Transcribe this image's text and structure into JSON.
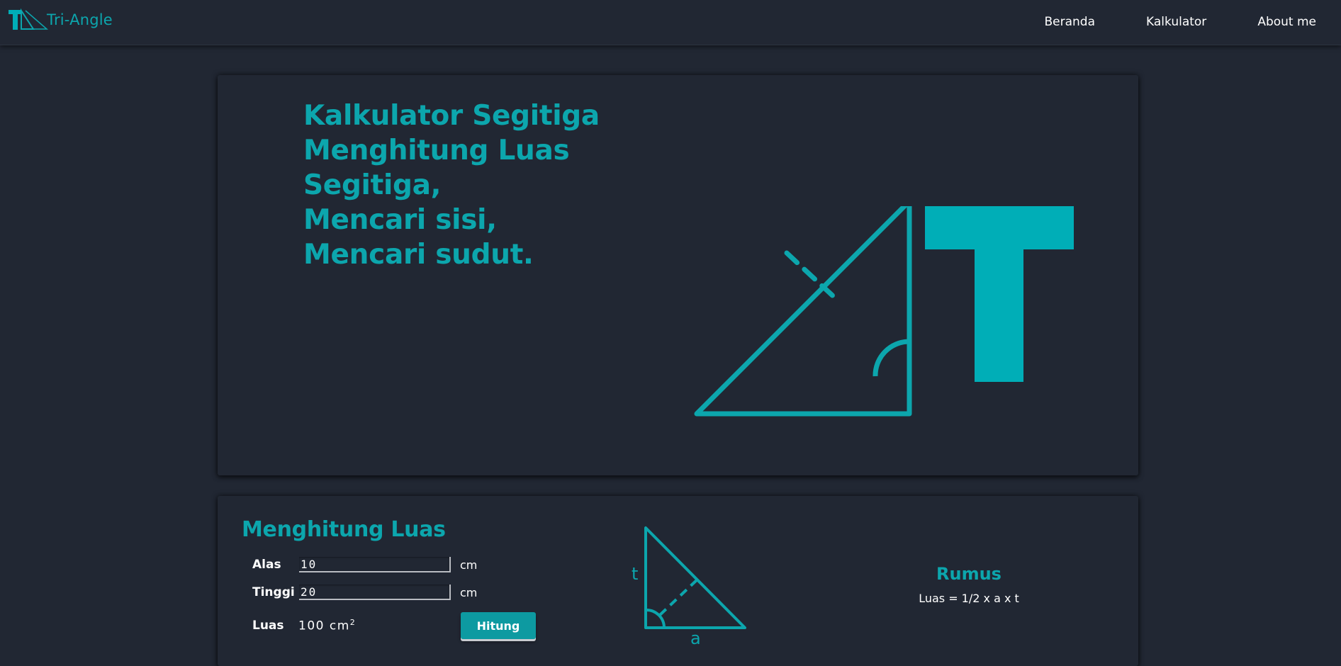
{
  "navbar": {
    "brand_text": "Tri-Angle",
    "links": [
      "Beranda",
      "Kalkulator",
      "About me"
    ]
  },
  "hero": {
    "title_lines": [
      "Kalkulator Segitiga",
      "Menghitung Luas",
      "Segitiga,",
      "Mencari sisi,",
      "Mencari sudut."
    ]
  },
  "calc": {
    "title": "Menghitung Luas",
    "alas_label": "Alas",
    "alas_value": "10",
    "tinggi_label": "Tinggi",
    "tinggi_value": "20",
    "unit": "cm",
    "luas_label": "Luas",
    "luas_value": "100",
    "luas_unit": "cm",
    "luas_unit_exp": "2",
    "button_label": "Hitung",
    "diagram_t": "t",
    "diagram_a": "a",
    "rumus_title": "Rumus",
    "rumus_text": "Luas = 1/2 x a x t"
  },
  "colors": {
    "background": "#212733",
    "accent": "#0ca6ad",
    "logo_fill": "#00aeb7",
    "button": "#0d9aa1",
    "text": "#ffffff"
  },
  "icons": {
    "brand_logo": "triangle-t-logo",
    "hero_logo": "triangle-t-logo-large",
    "diagram": "right-triangle-diagram"
  }
}
